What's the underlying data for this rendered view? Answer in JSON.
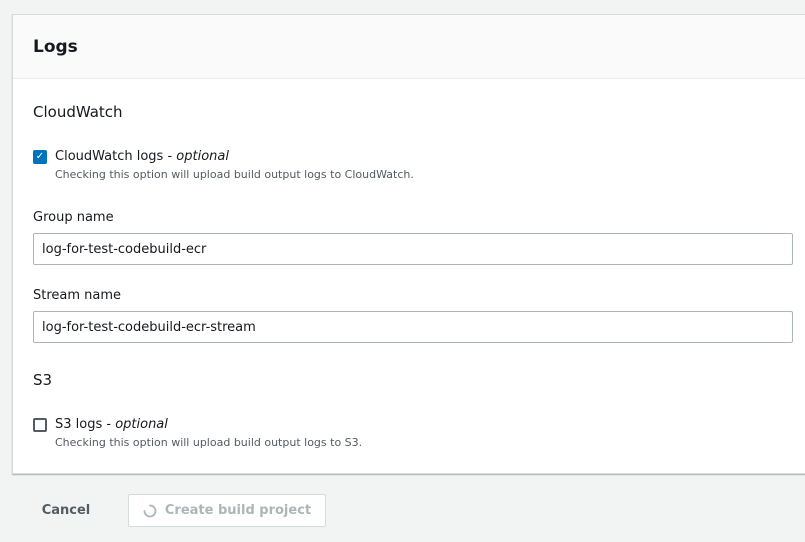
{
  "panel": {
    "title": "Logs"
  },
  "cloudwatch": {
    "section_title": "CloudWatch",
    "checkbox": {
      "label": "CloudWatch logs - ",
      "optional": "optional",
      "description": "Checking this option will upload build output logs to CloudWatch.",
      "checked": true
    },
    "group_name": {
      "label": "Group name",
      "value": "log-for-test-codebuild-ecr"
    },
    "stream_name": {
      "label": "Stream name",
      "value": "log-for-test-codebuild-ecr-stream"
    }
  },
  "s3": {
    "section_title": "S3",
    "checkbox": {
      "label": "S3 logs - ",
      "optional": "optional",
      "description": "Checking this option will upload build output logs to S3.",
      "checked": false
    }
  },
  "actions": {
    "cancel_label": "Cancel",
    "create_label": "Create build project",
    "create_icon": "spinner-icon"
  },
  "colors": {
    "accent": "#0073bb",
    "disabled_text": "#aab7b8",
    "background": "#f2f3f3"
  }
}
